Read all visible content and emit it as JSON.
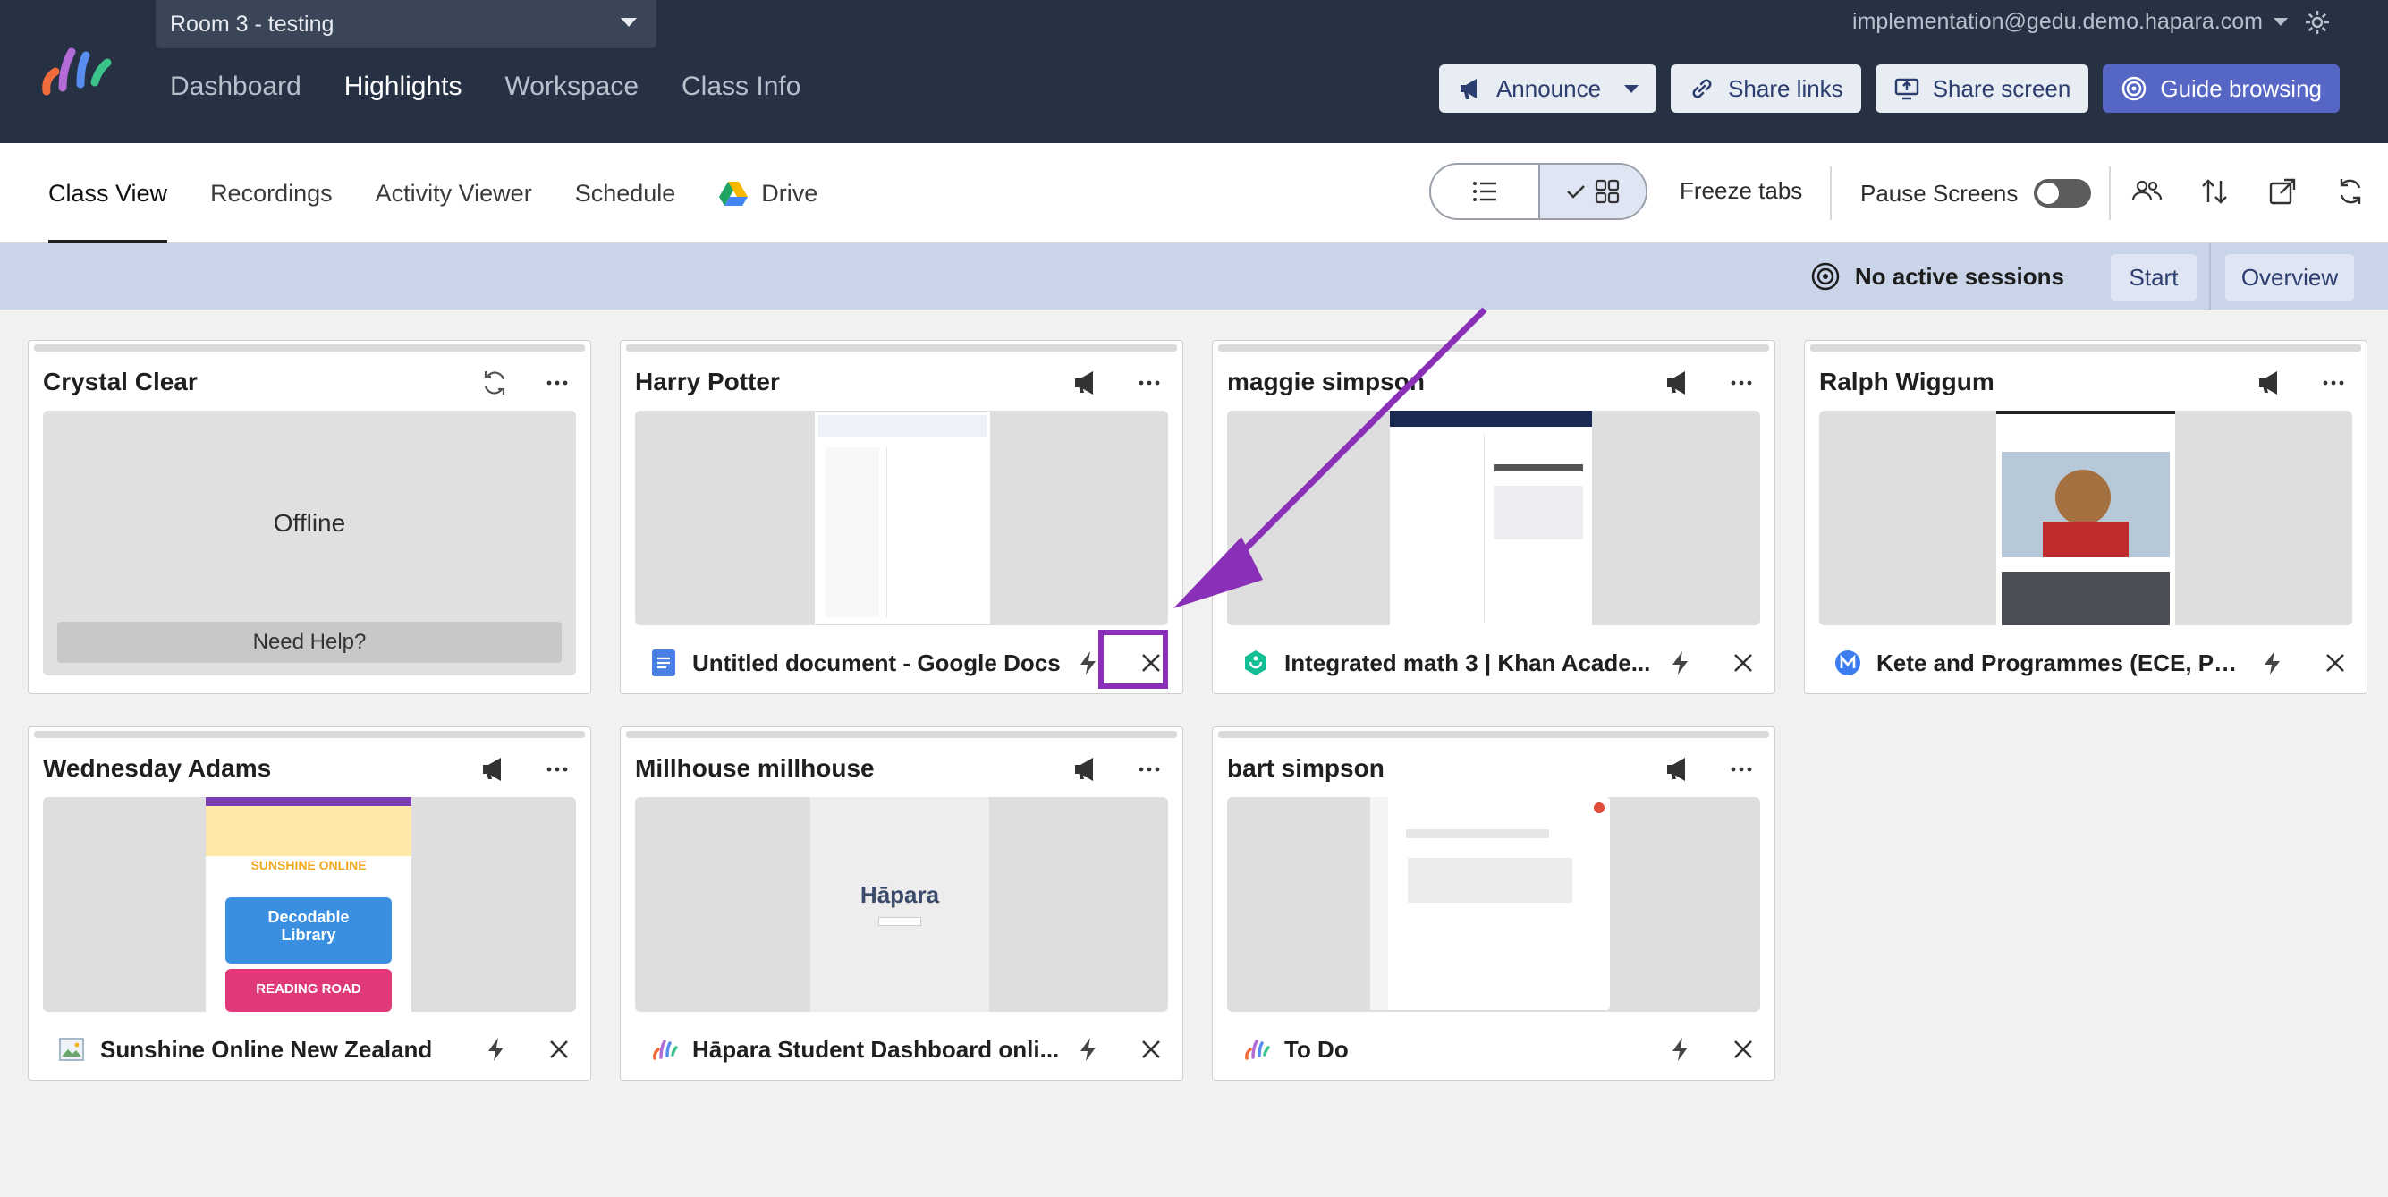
{
  "header": {
    "room": "Room 3 - testing",
    "nav": [
      "Dashboard",
      "Highlights",
      "Workspace",
      "Class Info"
    ],
    "user_email": "implementation@gedu.demo.hapara.com",
    "buttons": {
      "announce": "Announce",
      "share_links": "Share links",
      "share_screen": "Share screen",
      "guide_browsing": "Guide browsing"
    }
  },
  "subnav": {
    "tabs": [
      "Class View",
      "Recordings",
      "Activity Viewer",
      "Schedule",
      "Drive"
    ],
    "freeze_tabs": "Freeze tabs",
    "pause_screens": "Pause Screens"
  },
  "sessions": {
    "status": "No active sessions",
    "start": "Start",
    "overview": "Overview"
  },
  "students": [
    {
      "name": "Crystal Clear",
      "offline": "Offline",
      "help": "Need Help?"
    },
    {
      "name": "Harry Potter",
      "tab": "Untitled document - Google Docs"
    },
    {
      "name": "maggie simpson",
      "tab": "Integrated math 3 | Khan Acade..."
    },
    {
      "name": "Ralph Wiggum",
      "tab": "Kete and Programmes (ECE, Pri..."
    },
    {
      "name": "Wednesday Adams",
      "tab": "Sunshine Online New Zealand"
    },
    {
      "name": "Millhouse millhouse",
      "tab": "Hāpara Student Dashboard onli..."
    },
    {
      "name": "bart simpson",
      "tab": "To Do"
    }
  ],
  "thumbnails": {
    "wednesday_banner": "SUNSHINE ONLINE",
    "wednesday_tile1": "Decodable Library",
    "wednesday_tile2": "READING ROAD",
    "millhouse_logo": "Hāpara"
  },
  "colors": {
    "topbar": "#263143",
    "accent": "#5566c4",
    "annotation": "#8a2fb8"
  }
}
